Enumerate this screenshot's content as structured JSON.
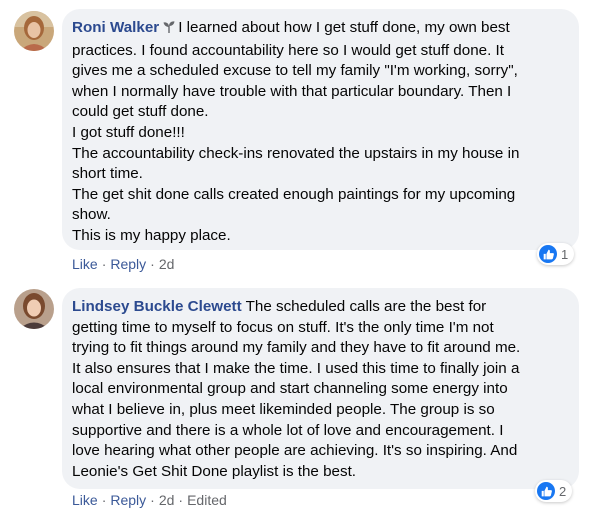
{
  "colors": {
    "bubble_bg": "#f0f2f5",
    "author": "#2c4a8f",
    "action_link": "#3b5998",
    "meta_text": "#65676b",
    "like_blue": "#1877f2"
  },
  "comments": [
    {
      "author": "Roni Walker",
      "author_badge_icon": "sprout-icon",
      "lines": [
        "I learned about how I get stuff done, my own best",
        "practices. I found accountability here so I would get stuff done. It",
        "gives me a scheduled excuse to tell my family \"I'm working, sorry\",",
        "when I normally have trouble with that particular boundary. Then I",
        "could get stuff done.",
        "I got stuff done!!!",
        "The accountability check-ins renovated the upstairs in my house in",
        "short time.",
        "The get shit done calls created enough paintings for my upcoming",
        "show.",
        "This is my happy place."
      ],
      "actions": {
        "like": "Like",
        "reply": "Reply",
        "time": "2d"
      },
      "reaction_icon": "like-icon",
      "reaction_count": "1"
    },
    {
      "author": "Lindsey Buckle Clewett",
      "lines": [
        "The scheduled calls are the best for",
        "getting time to myself to focus on stuff. It's the only time I'm not",
        "trying to fit things around my family and they have to fit around me.",
        "It also ensures that I make the time. I used this time to finally join a",
        "local environmental group and start channeling some energy into",
        "what I believe in, plus meet likeminded people. The group is so",
        "supportive and there is a whole lot of love and encouragement. I",
        "love hearing what other people are achieving. It's so inspiring. And",
        "Leonie's Get Shit Done playlist is the best."
      ],
      "actions": {
        "like": "Like",
        "reply": "Reply",
        "time": "2d",
        "edited": "Edited"
      },
      "reaction_icon": "like-icon",
      "reaction_count": "2"
    }
  ]
}
